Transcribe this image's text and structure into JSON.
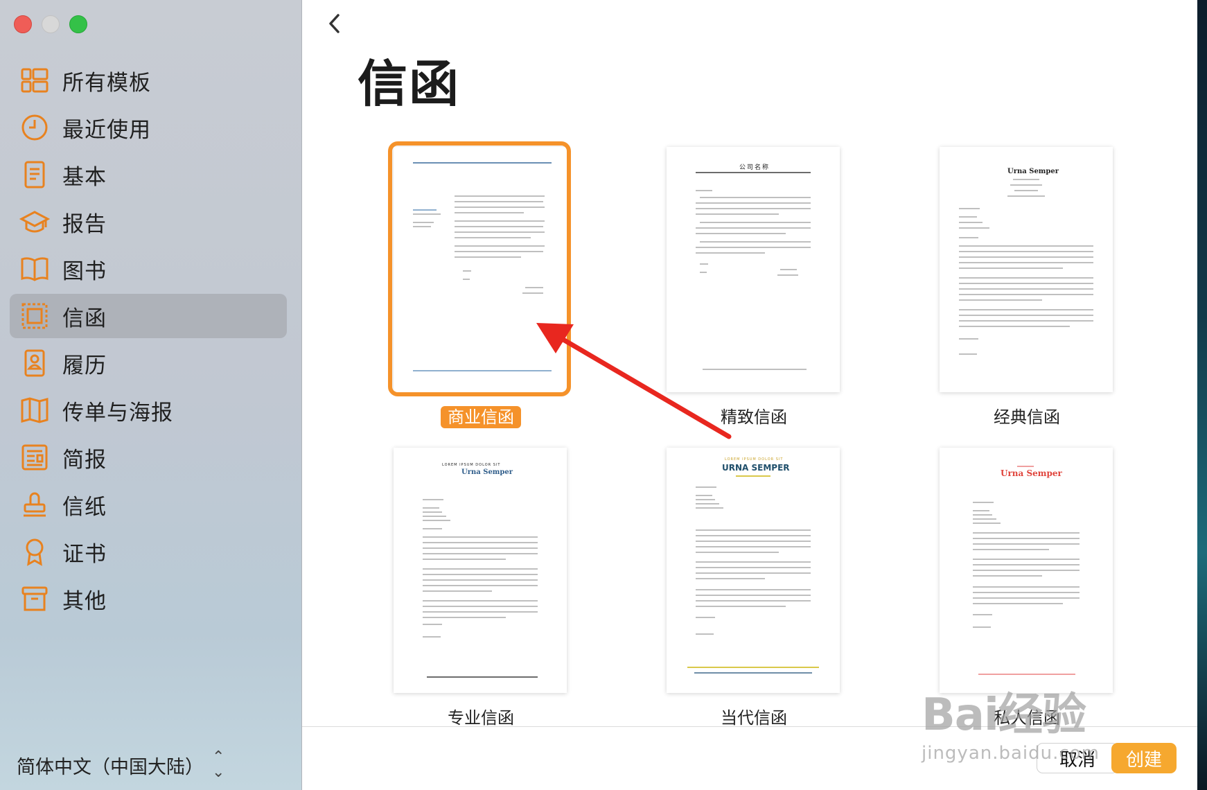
{
  "sidebar": {
    "items": [
      {
        "label": "所有模板",
        "icon": "all-templates-icon"
      },
      {
        "label": "最近使用",
        "icon": "clock-icon"
      },
      {
        "label": "基本",
        "icon": "document-icon"
      },
      {
        "label": "报告",
        "icon": "graduation-cap-icon"
      },
      {
        "label": "图书",
        "icon": "book-icon"
      },
      {
        "label": "信函",
        "icon": "stamp-letter-icon"
      },
      {
        "label": "履历",
        "icon": "resume-icon"
      },
      {
        "label": "传单与海报",
        "icon": "map-flyer-icon"
      },
      {
        "label": "简报",
        "icon": "newsletter-icon"
      },
      {
        "label": "信纸",
        "icon": "stamp-icon"
      },
      {
        "label": "证书",
        "icon": "ribbon-award-icon"
      },
      {
        "label": "其他",
        "icon": "archive-box-icon"
      }
    ],
    "active_index": 5,
    "language": "简体中文（中国大陆）"
  },
  "main": {
    "title": "信函",
    "templates": [
      {
        "label": "商业信函",
        "selected": true
      },
      {
        "label": "精致信函",
        "selected": false
      },
      {
        "label": "经典信函",
        "selected": false
      },
      {
        "label": "专业信函",
        "selected": false
      },
      {
        "label": "当代信函",
        "selected": false
      },
      {
        "label": "私人信函",
        "selected": false
      }
    ],
    "thumb_text": {
      "company_name": "公司名称",
      "urna_semper": "Urna Semper",
      "urna_semper_caps": "URNA SEMPER",
      "lorem_caps": "LOREM IPSUM DOLOR SIT"
    }
  },
  "buttons": {
    "cancel": "取消",
    "create": "创建"
  },
  "watermark": {
    "big": "Bai经验",
    "small": "jingyan.baidu.com"
  },
  "colors": {
    "accent": "#f5922a",
    "icon": "#e8821f",
    "arrow": "#e8271f"
  }
}
